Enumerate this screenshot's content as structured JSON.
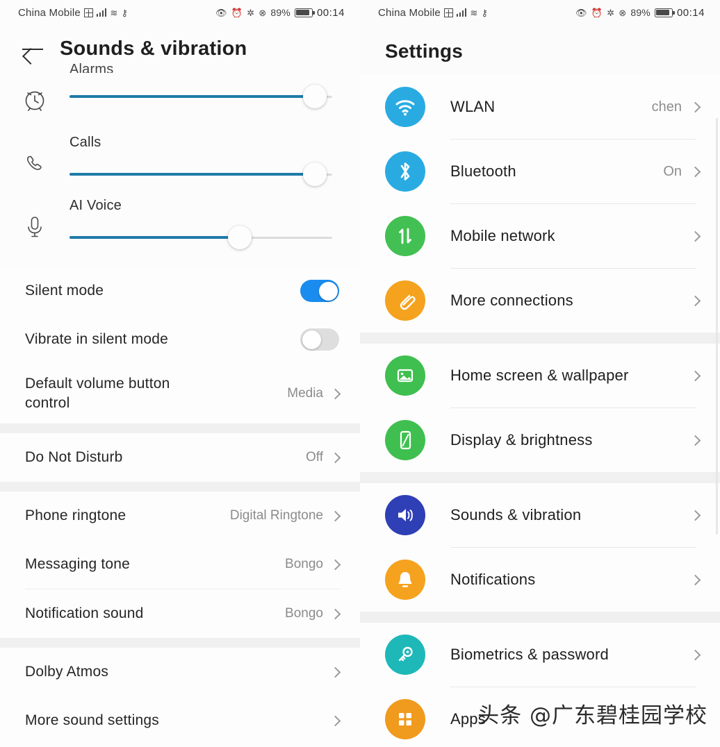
{
  "status_bar": {
    "carrier": "China Mobile",
    "battery_percent": "89%",
    "time": "00:14",
    "icons": [
      "hd-icon",
      "signal-bars-icon",
      "data-icon",
      "vpn-key-icon",
      "eye-icon",
      "alarm-icon",
      "bluetooth-icon",
      "mute-icon"
    ]
  },
  "left_screen": {
    "title": "Sounds & vibration",
    "back_icon": "back-arrow-icon",
    "sliders": [
      {
        "label": "Alarms",
        "icon": "alarm-clock-icon",
        "value": 100,
        "clipped": true
      },
      {
        "label": "Calls",
        "icon": "phone-icon",
        "value": 100,
        "clipped": false
      },
      {
        "label": "AI Voice",
        "icon": "microphone-icon",
        "value": 73,
        "clipped": false
      }
    ],
    "toggle_rows": [
      {
        "label": "Silent mode",
        "state": "on"
      },
      {
        "label": "Vibrate in silent mode",
        "state": "off"
      }
    ],
    "volume_button_row": {
      "label": "Default volume button control",
      "value": "Media"
    },
    "dnd_row": {
      "label": "Do Not Disturb",
      "value": "Off"
    },
    "tone_rows": [
      {
        "label": "Phone ringtone",
        "value": "Digital Ringtone"
      },
      {
        "label": "Messaging tone",
        "value": "Bongo"
      },
      {
        "label": "Notification sound",
        "value": "Bongo"
      }
    ],
    "bottom_rows": [
      {
        "label": "Dolby Atmos",
        "value": ""
      },
      {
        "label": "More sound settings",
        "value": ""
      }
    ]
  },
  "right_screen": {
    "title": "Settings",
    "groups": [
      {
        "items": [
          {
            "label": "WLAN",
            "value": "chen",
            "icon": "wifi-icon",
            "color": "#29abe2"
          },
          {
            "label": "Bluetooth",
            "value": "On",
            "icon": "bluetooth-icon",
            "color": "#29abe2"
          },
          {
            "label": "Mobile network",
            "value": "",
            "icon": "mobile-data-icon",
            "color": "#43c053"
          },
          {
            "label": "More connections",
            "value": "",
            "icon": "paperclip-icon",
            "color": "#f5a21e"
          }
        ]
      },
      {
        "items": [
          {
            "label": "Home screen & wallpaper",
            "value": "",
            "icon": "image-icon",
            "color": "#3fbf4f"
          },
          {
            "label": "Display & brightness",
            "value": "",
            "icon": "phone-brightness-icon",
            "color": "#3fbf4f"
          }
        ]
      },
      {
        "items": [
          {
            "label": "Sounds & vibration",
            "value": "",
            "icon": "speaker-icon",
            "color": "#2f3fb5"
          },
          {
            "label": "Notifications",
            "value": "",
            "icon": "bell-icon",
            "color": "#f5a21e"
          }
        ]
      },
      {
        "items": [
          {
            "label": "Biometrics & password",
            "value": "",
            "icon": "key-icon",
            "color": "#1eb8b8"
          },
          {
            "label": "Apps",
            "value": "",
            "icon": "grid-apps-icon",
            "color": "#f09a1e"
          }
        ]
      }
    ]
  },
  "watermark": "头条 @广东碧桂园学校"
}
